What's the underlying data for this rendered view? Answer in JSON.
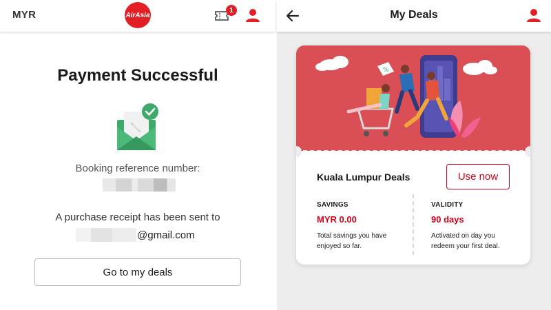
{
  "left": {
    "header": {
      "currency": "MYR",
      "logo_text": "AirAsia",
      "ticket_badge": "1"
    },
    "title": "Payment Successful",
    "booking_label": "Booking reference number:",
    "receipt_text": "A purchase receipt has been sent to",
    "email_domain": "@gmail.com",
    "go_button": "Go to my deals"
  },
  "right": {
    "header": {
      "title": "My Deals"
    },
    "card": {
      "name": "Kuala Lumpur Deals",
      "use_button": "Use now",
      "savings": {
        "label": "SAVINGS",
        "value": "MYR 0.00",
        "desc": "Total savings you have enjoyed so far."
      },
      "validity": {
        "label": "VALIDITY",
        "value": "90 days",
        "desc": "Activated on day you redeem your first deal."
      }
    }
  },
  "colors": {
    "brand_red": "#e31f26",
    "accent_red": "#d0021b",
    "banner_red": "#d94f55",
    "envelope_green": "#3fa86b"
  },
  "icons": [
    "ticket-icon",
    "user-icon",
    "back-arrow-icon",
    "envelope-check-icon"
  ]
}
